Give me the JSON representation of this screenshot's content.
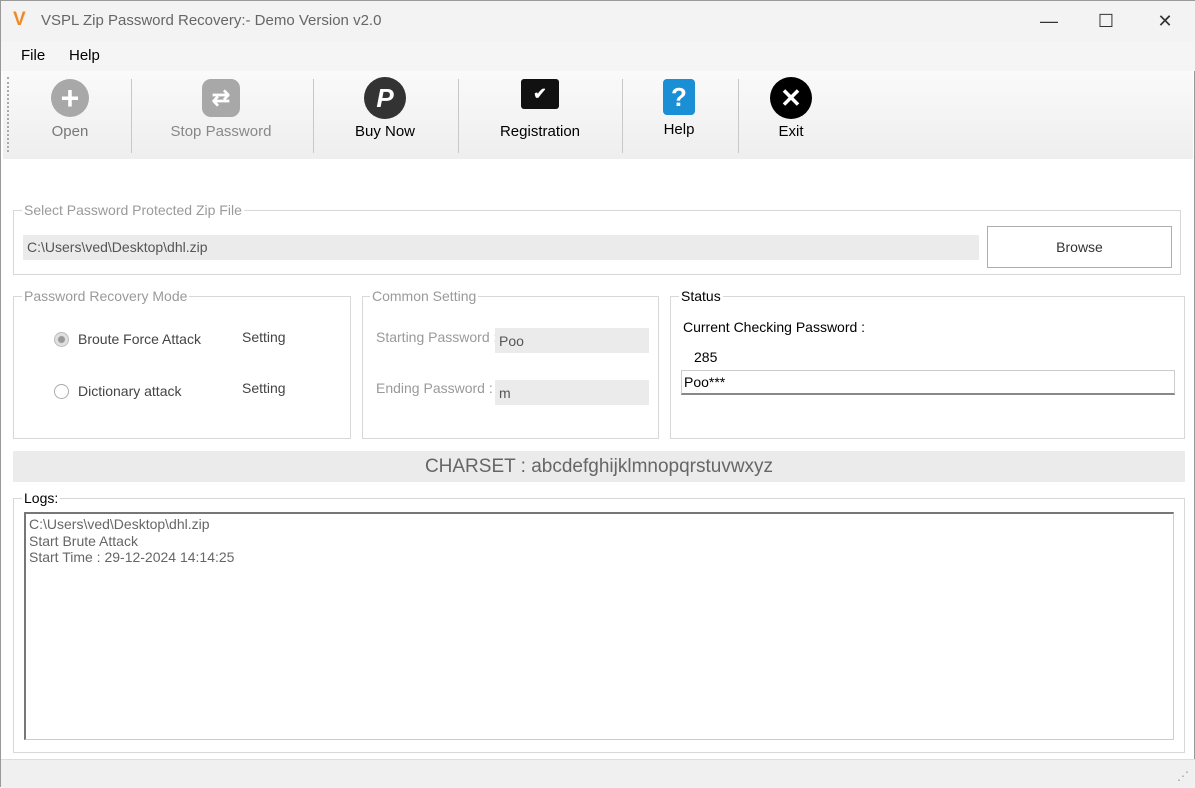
{
  "window": {
    "title": "VSPL Zip Password Recovery:- Demo Version v2.0",
    "minimize": "—",
    "maximize": "☐",
    "close": "✕"
  },
  "menu": {
    "file": "File",
    "help": "Help"
  },
  "toolbar": {
    "open": "Open",
    "stop": "Stop Password",
    "buy": "Buy Now",
    "registration": "Registration",
    "help": "Help",
    "exit": "Exit"
  },
  "file_group": {
    "legend": "Select Password Protected Zip File",
    "path": "C:\\Users\\ved\\Desktop\\dhl.zip",
    "browse": "Browse"
  },
  "mode": {
    "legend": "Password Recovery Mode",
    "brute": "Broute Force Attack",
    "dictionary": "Dictionary attack",
    "setting1": "Setting",
    "setting2": "Setting"
  },
  "common": {
    "legend": "Common Setting",
    "start_label": "Starting Password :",
    "start_value": "Poo",
    "end_label": "Ending Password :",
    "end_value": "m"
  },
  "status": {
    "legend": "Status",
    "current_label": "Current Checking Password :",
    "count": "285",
    "current": "Poo***"
  },
  "charset": "CHARSET : abcdefghijklmnopqrstuvwxyz",
  "logs": {
    "legend": "Logs:",
    "lines": [
      "C:\\Users\\ved\\Desktop\\dhl.zip",
      "Start Brute Attack",
      "Start Time : 29-12-2024 14:14:25"
    ]
  }
}
